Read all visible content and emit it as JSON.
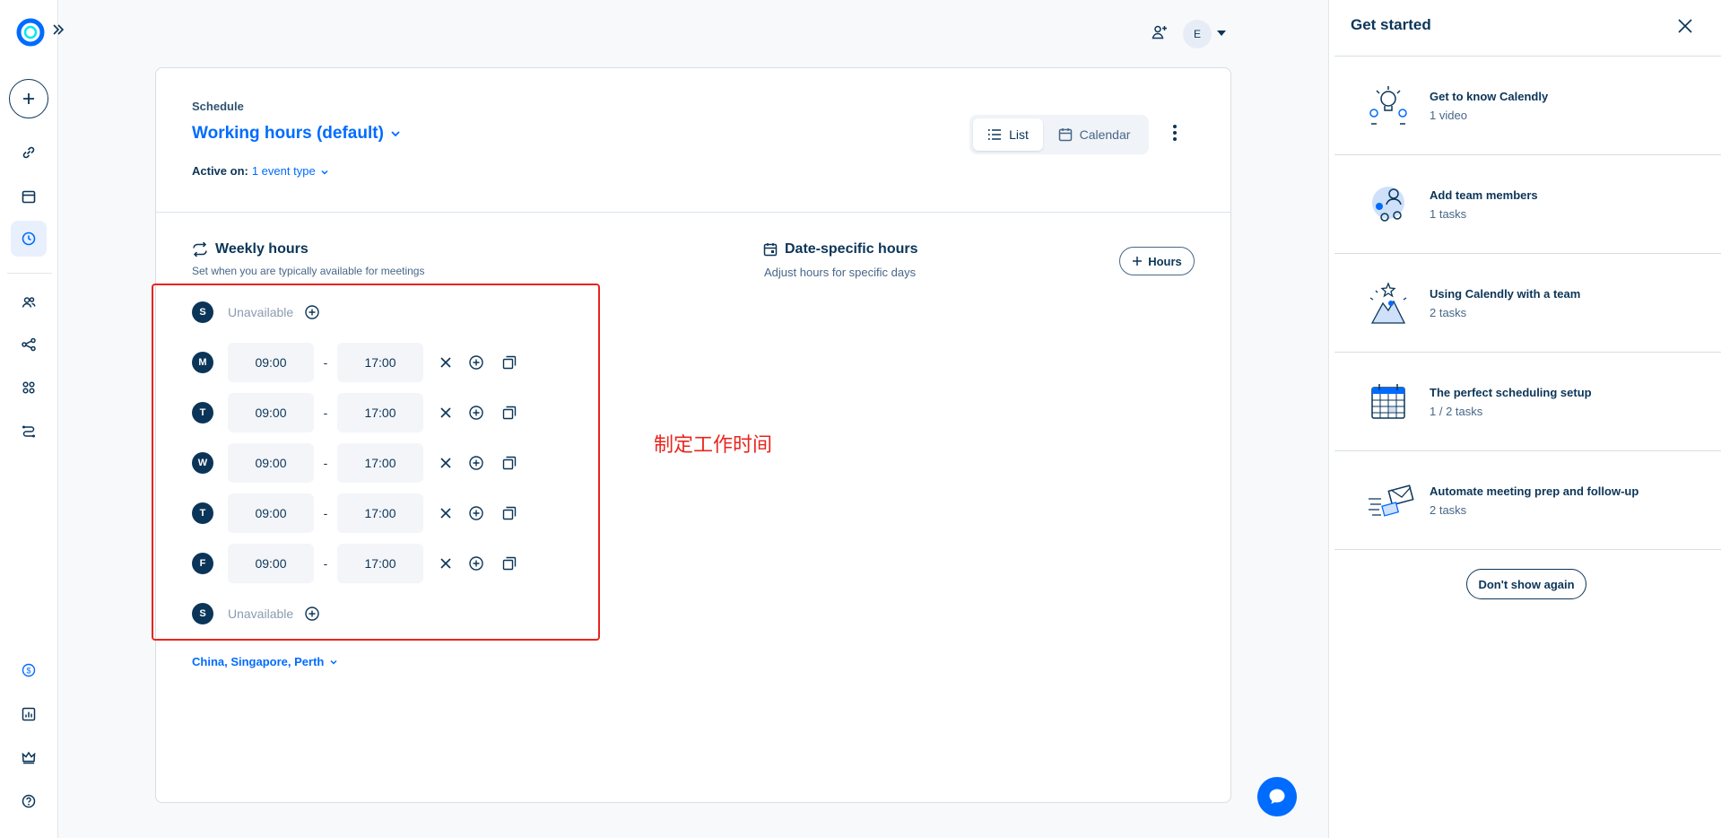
{
  "header": {
    "avatar_initial": "E"
  },
  "schedule": {
    "label": "Schedule",
    "title": "Working hours (default)",
    "active_on_label": "Active on:",
    "active_on_value": "1 event type",
    "view_toggle": {
      "list_label": "List",
      "calendar_label": "Calendar"
    }
  },
  "weekly_hours": {
    "title": "Weekly hours",
    "subtitle": "Set when you are typically available for meetings",
    "unavailable_label": "Unavailable",
    "dash": "-",
    "days": [
      {
        "letter": "S",
        "available": false
      },
      {
        "letter": "M",
        "available": true,
        "start": "09:00",
        "end": "17:00"
      },
      {
        "letter": "T",
        "available": true,
        "start": "09:00",
        "end": "17:00"
      },
      {
        "letter": "W",
        "available": true,
        "start": "09:00",
        "end": "17:00"
      },
      {
        "letter": "T",
        "available": true,
        "start": "09:00",
        "end": "17:00"
      },
      {
        "letter": "F",
        "available": true,
        "start": "09:00",
        "end": "17:00"
      },
      {
        "letter": "S",
        "available": false
      }
    ]
  },
  "date_specific": {
    "title": "Date-specific hours",
    "subtitle": "Adjust hours for specific days",
    "button_label": "Hours"
  },
  "timezone": "China, Singapore, Perth",
  "annotation": "制定工作时间",
  "get_started": {
    "title": "Get started",
    "items": [
      {
        "title": "Get to know Calendly",
        "subtitle": "1 video",
        "icon": "lightbulb-icon"
      },
      {
        "title": "Add team members",
        "subtitle": "1 tasks",
        "icon": "team-icon"
      },
      {
        "title": "Using Calendly with a team",
        "subtitle": "2 tasks",
        "icon": "hiker-icon"
      },
      {
        "title": "The perfect scheduling setup",
        "subtitle": "1 / 2 tasks",
        "icon": "calendar-grid-icon"
      },
      {
        "title": "Automate meeting prep and follow-up",
        "subtitle": "2 tasks",
        "icon": "envelope-icon"
      }
    ],
    "dont_show_label": "Don't show again"
  },
  "colors": {
    "accent": "#006bff",
    "navy": "#0b3558",
    "annotation": "#e8251e"
  }
}
